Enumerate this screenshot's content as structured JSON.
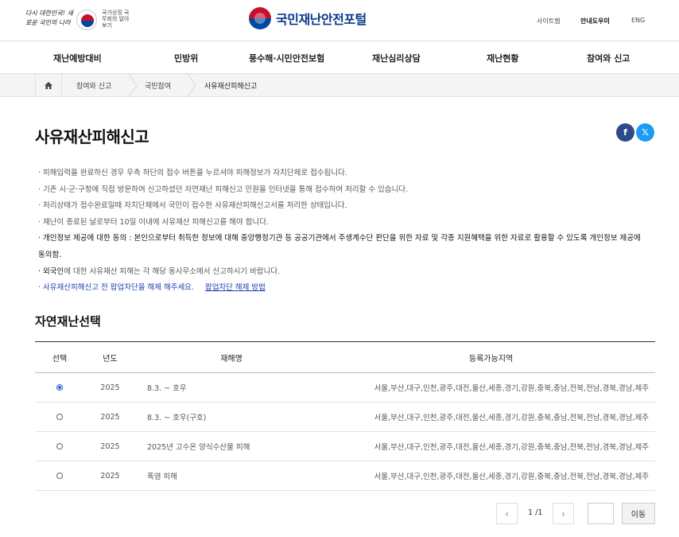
{
  "header": {
    "slogan": "다시 대한민국! 새로운 국민의 나라",
    "gov_text": "국가상징 국무회의 알아보기",
    "logo_text": "국민재난안전포털",
    "util": [
      "사이트맵",
      "안내도우미",
      "ENG"
    ]
  },
  "gnb": [
    "재난예방대비",
    "민방위",
    "풍수해·시민안전보험",
    "재난심리상담",
    "재난현황",
    "참여와 신고"
  ],
  "breadcrumb": [
    "참여와 신고",
    "국민참여",
    "사유재산피해신고"
  ],
  "page_title": "사유재산피해신고",
  "social": {
    "facebook": "f",
    "x": "𝕏"
  },
  "notices": [
    "· 피해입력을 완료하신 경우 우측 하단의 접수 버튼을 누르셔야 피해정보가 자치단체로 접수됩니다.",
    "· 기존 시·군·구청에 직접 방문하여 신고하셨던 자연재난 피해신고 민원을 인터넷을 통해 접수하여 처리할 수 있습니다.",
    "· 처리상태가 접수완료일때 자치단체에서 국민이 접수한 사유재산피해신고서를 처리한 상태입니다.",
    "· 재난이 종료된 날로부터 10일 이내에 사유재산 피해신고를 해야 합니다."
  ],
  "notice_privacy": "· 개인정보 제공에 대한 동의 : 본인으로부터 취득한 정보에 대해 중앙행정기관 등 공공기관에서 주생계수단 판단을 위한 자료 및 각종 지원혜택을 위한 자료로 활용할 수 있도록 개인정보 제공에 동의함.",
  "notice_foreign": {
    "dark": "· 외국인",
    "rest": "에 대한 사유재산 피해는 각 해당 동사무소에서 신고하시기 바랍니다."
  },
  "notice_popup": {
    "text": "· 사유재산피해신고 전 팝업차단을 해제 해주세요.",
    "link": "팝업차단 해제 방법"
  },
  "section_title": "자연재난선택",
  "table": {
    "headers": [
      "선택",
      "년도",
      "재해명",
      "등록가능지역"
    ],
    "rows": [
      {
        "selected": true,
        "year": "2025",
        "name": "8.3. ~ 호우",
        "regions": "서울,부산,대구,인천,광주,대전,울산,세종,경기,강원,충북,충남,전북,전남,경북,경남,제주"
      },
      {
        "selected": false,
        "year": "2025",
        "name": "8.3. ~ 호우(구호)",
        "regions": "서울,부산,대구,인천,광주,대전,울산,세종,경기,강원,충북,충남,전북,전남,경북,경남,제주"
      },
      {
        "selected": false,
        "year": "2025",
        "name": "2025년 고수온 양식수산물 피해",
        "regions": "서울,부산,대구,인천,광주,대전,울산,세종,경기,강원,충북,충남,전북,전남,경북,경남,제주"
      },
      {
        "selected": false,
        "year": "2025",
        "name": "폭염 피해",
        "regions": "서울,부산,대구,인천,광주,대전,울산,세종,경기,강원,충북,충남,전북,전남,경북,경남,제주"
      }
    ]
  },
  "pagination": {
    "page": "1 /1",
    "prev": "‹",
    "next": "›",
    "go_label": "이동"
  }
}
